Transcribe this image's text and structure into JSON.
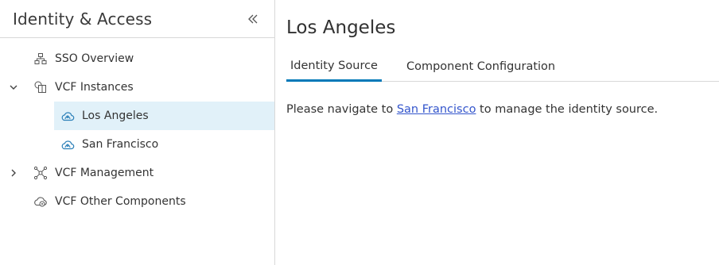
{
  "sidebar": {
    "title": "Identity & Access",
    "items": [
      {
        "label": "SSO Overview",
        "icon": "sitemap-icon"
      },
      {
        "label": "VCF Instances",
        "icon": "instances-icon",
        "expanded": true
      },
      {
        "label": "Los Angeles",
        "icon": "cloud-icon",
        "selected": true
      },
      {
        "label": "San Francisco",
        "icon": "cloud-icon"
      },
      {
        "label": "VCF Management",
        "icon": "network-icon",
        "expanded": false
      },
      {
        "label": "VCF Other Components",
        "icon": "components-icon"
      }
    ]
  },
  "main": {
    "title": "Los Angeles",
    "tabs": [
      {
        "label": "Identity Source",
        "active": true
      },
      {
        "label": "Component Configuration",
        "active": false
      }
    ],
    "message": {
      "before": "Please navigate to ",
      "link": "San Francisco",
      "after": " to manage the identity source."
    }
  },
  "colors": {
    "accent": "#0079b8",
    "selected_bg": "#e1f1f9",
    "link": "#3355cc",
    "border": "#d8d8d8"
  }
}
